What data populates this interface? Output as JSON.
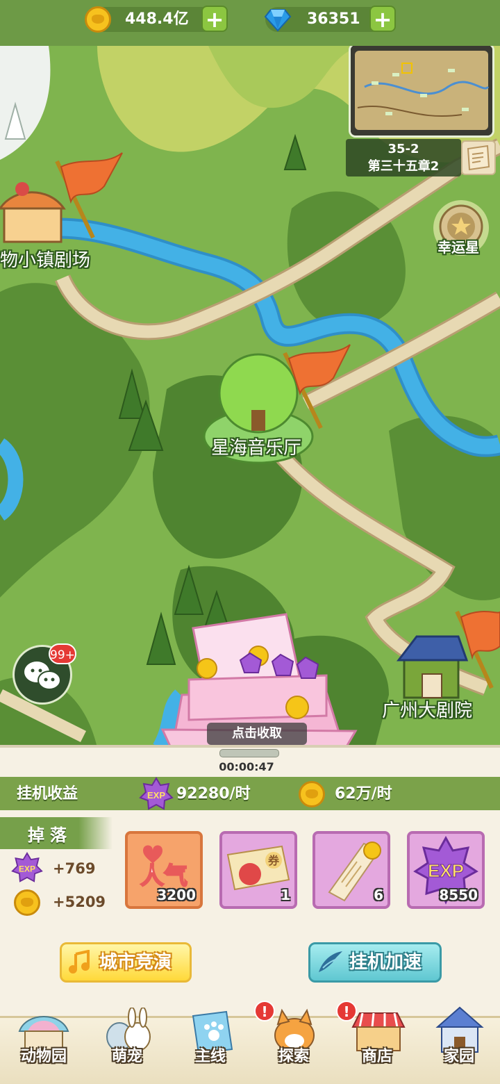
{
  "top_bar": {
    "coins_value": "448.4亿",
    "gems_value": "36351",
    "add_symbol": "+"
  },
  "map": {
    "chapter_stage": "35-2",
    "chapter_name": "第三十五章2",
    "lucky_star_label": "幸运星",
    "locations": [
      {
        "name": "物小镇剧场"
      },
      {
        "name": "星海音乐厅"
      },
      {
        "name": "广州大剧院"
      }
    ],
    "wechat_badge": "99+",
    "collect_label": "点击收取",
    "timer": "00:00:47"
  },
  "idle": {
    "title": "挂机收益",
    "exp_rate": "92280/时",
    "coin_rate": "62万/时"
  },
  "drops": {
    "title": "掉落",
    "exp": "+769",
    "coin": "+5209",
    "exp_badge_text": "EXP",
    "items": [
      {
        "icon": "popularity-icon",
        "caption": "人气",
        "count": "3200",
        "bg": "#f6a36b"
      },
      {
        "icon": "ticket-icon",
        "caption": "券",
        "count": "1",
        "bg": "#e4a8df"
      },
      {
        "icon": "certificate-scroll-icon",
        "caption": "",
        "count": "6",
        "bg": "#e4a8df"
      },
      {
        "icon": "exp-icon",
        "caption": "EXP",
        "count": "8550",
        "bg": "#e4a8df"
      }
    ]
  },
  "actions": {
    "city_contest": "城市竞演",
    "idle_speedup": "挂机加速"
  },
  "nav": [
    {
      "label": "动物园",
      "alert": false
    },
    {
      "label": "萌宠",
      "alert": false
    },
    {
      "label": "主线",
      "alert": false
    },
    {
      "label": "探索",
      "alert": true
    },
    {
      "label": "商店",
      "alert": true
    },
    {
      "label": "家园",
      "alert": false
    }
  ],
  "alert_symbol": "!",
  "colors": {
    "map_grass": "#7fb44e",
    "map_hill": "#5a8f36",
    "river": "#43b1e6",
    "road": "#e7d9b3",
    "flag": "#ee7133"
  }
}
